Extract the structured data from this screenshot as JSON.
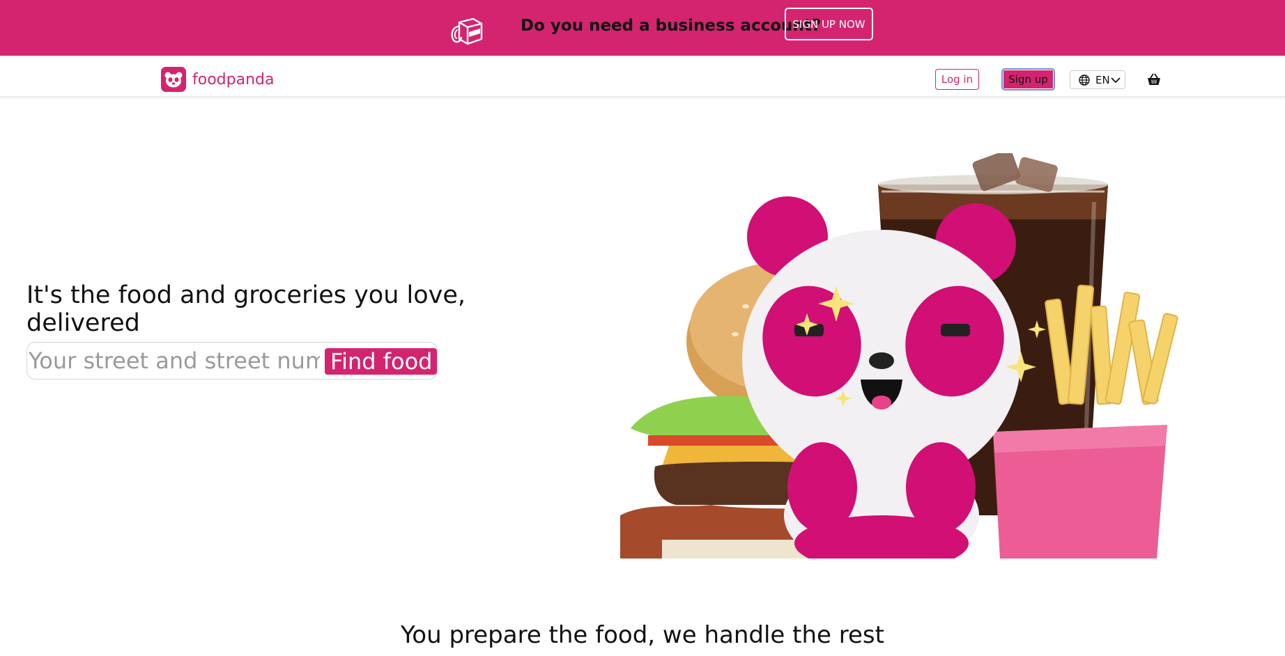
{
  "banner": {
    "text": "Do you need a business account?",
    "cta_label": "SIGN UP NOW",
    "icon": "delivery-bag-icon"
  },
  "header": {
    "brand": "foodpanda",
    "logo_icon": "panda-logo-icon",
    "login_label": "Log in",
    "signup_label": "Sign up",
    "language": "EN",
    "language_icon": "globe-icon",
    "cart_icon": "basket-icon"
  },
  "hero": {
    "title": "It's the food and groceries you love, delivered",
    "search_placeholder": "Your street and street number",
    "search_value": "",
    "find_button_label": "Find food",
    "illustration": "panda-mascot-with-burger-fries-drink"
  },
  "section": {
    "title": "You prepare the food, we handle the rest"
  },
  "colors": {
    "brand": "#d4246f",
    "banner_bg": "#d4246f",
    "page_bg": "#ffffff"
  }
}
